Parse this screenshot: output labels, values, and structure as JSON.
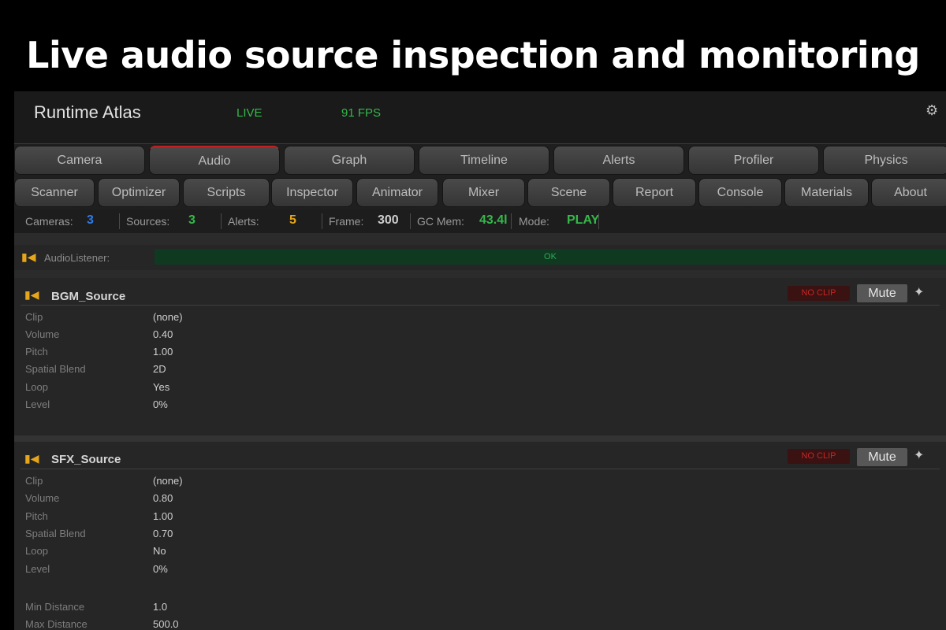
{
  "headline": "Live audio source inspection and monitoring",
  "app": {
    "title": "Runtime Atlas",
    "live_label": "LIVE",
    "fps_label": "91 FPS",
    "gear_icon": "gear-icon"
  },
  "tabs_row1": [
    "Camera",
    "Audio",
    "Graph",
    "Timeline",
    "Alerts",
    "Profiler",
    "Physics"
  ],
  "tabs_row2": [
    "Scanner",
    "Optimizer",
    "Scripts",
    "Inspector",
    "Animator",
    "Mixer",
    "Scene",
    "Report",
    "Console",
    "Materials",
    "About"
  ],
  "active_tab": "Audio",
  "stats": {
    "cameras_label": "Cameras:",
    "cameras_value": "3",
    "cameras_color": "#2f7be6",
    "sources_label": "Sources:",
    "sources_value": "3",
    "sources_color": "#35b84a",
    "alerts_label": "Alerts:",
    "alerts_value": "5",
    "alerts_color": "#e5a619",
    "frame_label": "Frame:",
    "frame_value": "300",
    "frame_color": "#cfcfcf",
    "gcmem_label": "GC Mem:",
    "gcmem_value": "43.4l",
    "gcmem_color": "#35b84a",
    "mode_label": "Mode:",
    "mode_value": "PLAY",
    "mode_color": "#35b84a"
  },
  "listener": {
    "label": "AudioListener:",
    "status": "OK",
    "icon": "speaker-icon"
  },
  "sources": [
    {
      "name": "BGM_Source",
      "clip_status": "NO CLIP",
      "mute_label": "Mute",
      "props": [
        {
          "label": "Clip",
          "value": "(none)"
        },
        {
          "label": "Volume",
          "value": "0.40"
        },
        {
          "label": "Pitch",
          "value": "1.00"
        },
        {
          "label": "Spatial Blend",
          "value": "2D"
        },
        {
          "label": "Loop",
          "value": "Yes"
        },
        {
          "label": "Level",
          "value": "0%"
        }
      ]
    },
    {
      "name": "SFX_Source",
      "clip_status": "NO CLIP",
      "mute_label": "Mute",
      "props": [
        {
          "label": "Clip",
          "value": "(none)"
        },
        {
          "label": "Volume",
          "value": "0.80"
        },
        {
          "label": "Pitch",
          "value": "1.00"
        },
        {
          "label": "Spatial Blend",
          "value": "0.70"
        },
        {
          "label": "Loop",
          "value": "No"
        },
        {
          "label": "Level",
          "value": "0%"
        }
      ],
      "extra_props": [
        {
          "label": "Min Distance",
          "value": "1.0"
        },
        {
          "label": "Max Distance",
          "value": "500.0"
        }
      ]
    }
  ]
}
